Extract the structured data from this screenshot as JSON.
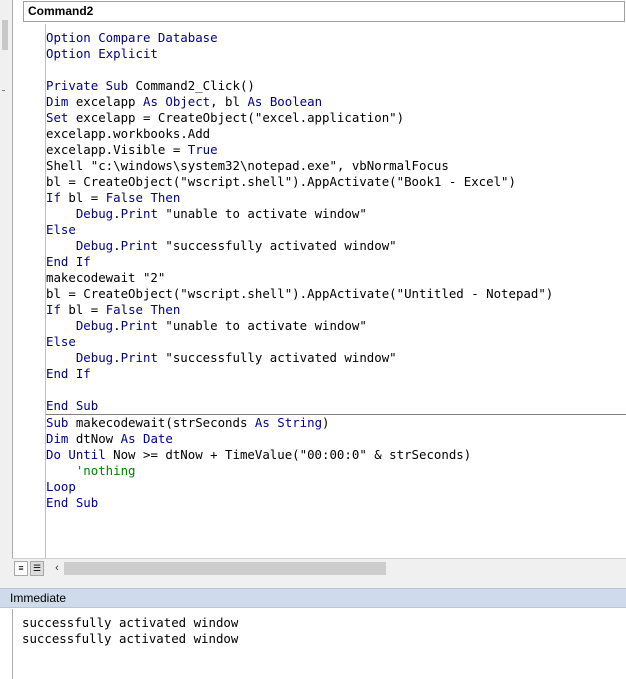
{
  "procedure_combo": {
    "value": "Command2"
  },
  "code_lines": [
    [
      {
        "t": "Option Compare Database",
        "c": "kw"
      }
    ],
    [
      {
        "t": "Option Explicit",
        "c": "kw"
      }
    ],
    [
      {
        "t": "",
        "c": "plain"
      }
    ],
    [
      {
        "t": "Private Sub ",
        "c": "kw"
      },
      {
        "t": "Command2_Click()",
        "c": "plain"
      }
    ],
    [
      {
        "t": "Dim ",
        "c": "kw"
      },
      {
        "t": "excelapp ",
        "c": "plain"
      },
      {
        "t": "As Object",
        "c": "kw"
      },
      {
        "t": ", bl ",
        "c": "plain"
      },
      {
        "t": "As Boolean",
        "c": "kw"
      }
    ],
    [
      {
        "t": "Set ",
        "c": "kw"
      },
      {
        "t": "excelapp = CreateObject(\"excel.application\")",
        "c": "plain"
      }
    ],
    [
      {
        "t": "excelapp.workbooks.Add",
        "c": "plain"
      }
    ],
    [
      {
        "t": "excelapp.Visible = ",
        "c": "plain"
      },
      {
        "t": "True",
        "c": "kw"
      }
    ],
    [
      {
        "t": "Shell \"c:\\windows\\system32\\notepad.exe\", vbNormalFocus",
        "c": "plain"
      }
    ],
    [
      {
        "t": "bl = CreateObject(\"wscript.shell\").AppActivate(\"Book1 - Excel\")",
        "c": "plain"
      }
    ],
    [
      {
        "t": "If ",
        "c": "kw"
      },
      {
        "t": "bl = ",
        "c": "plain"
      },
      {
        "t": "False Then",
        "c": "kw"
      }
    ],
    [
      {
        "t": "    Debug",
        "c": "kw"
      },
      {
        "t": ".",
        "c": "plain"
      },
      {
        "t": "Print ",
        "c": "kw"
      },
      {
        "t": "\"unable to activate window\"",
        "c": "plain"
      }
    ],
    [
      {
        "t": "Else",
        "c": "kw"
      }
    ],
    [
      {
        "t": "    Debug",
        "c": "kw"
      },
      {
        "t": ".",
        "c": "plain"
      },
      {
        "t": "Print ",
        "c": "kw"
      },
      {
        "t": "\"successfully activated window\"",
        "c": "plain"
      }
    ],
    [
      {
        "t": "End If",
        "c": "kw"
      }
    ],
    [
      {
        "t": "makecodewait \"2\"",
        "c": "plain"
      }
    ],
    [
      {
        "t": "bl = CreateObject(\"wscript.shell\").AppActivate(\"Untitled - Notepad\")",
        "c": "plain"
      }
    ],
    [
      {
        "t": "If ",
        "c": "kw"
      },
      {
        "t": "bl = ",
        "c": "plain"
      },
      {
        "t": "False Then",
        "c": "kw"
      }
    ],
    [
      {
        "t": "    Debug",
        "c": "kw"
      },
      {
        "t": ".",
        "c": "plain"
      },
      {
        "t": "Print ",
        "c": "kw"
      },
      {
        "t": "\"unable to activate window\"",
        "c": "plain"
      }
    ],
    [
      {
        "t": "Else",
        "c": "kw"
      }
    ],
    [
      {
        "t": "    Debug",
        "c": "kw"
      },
      {
        "t": ".",
        "c": "plain"
      },
      {
        "t": "Print ",
        "c": "kw"
      },
      {
        "t": "\"successfully activated window\"",
        "c": "plain"
      }
    ],
    [
      {
        "t": "End If",
        "c": "kw"
      }
    ],
    [
      {
        "t": "",
        "c": "plain"
      }
    ],
    [
      {
        "t": "End Sub",
        "c": "kw"
      }
    ],
    [
      {
        "t": "Sub ",
        "c": "kw"
      },
      {
        "t": "makecodewait(strSeconds ",
        "c": "plain"
      },
      {
        "t": "As String",
        "c": "kw"
      },
      {
        "t": ")",
        "c": "plain"
      }
    ],
    [
      {
        "t": "Dim ",
        "c": "kw"
      },
      {
        "t": "dtNow ",
        "c": "plain"
      },
      {
        "t": "As Date",
        "c": "kw"
      }
    ],
    [
      {
        "t": "Do Until ",
        "c": "kw"
      },
      {
        "t": "Now >= dtNow + TimeValue(\"00:00:0\" & strSeconds)",
        "c": "plain"
      }
    ],
    [
      {
        "t": "    'nothing",
        "c": "cmt"
      }
    ],
    [
      {
        "t": "Loop",
        "c": "kw"
      }
    ],
    [
      {
        "t": "End Sub",
        "c": "kw"
      }
    ]
  ],
  "immediate": {
    "title": "Immediate",
    "lines": [
      "successfully activated window",
      "successfully activated window"
    ]
  },
  "colors": {
    "keyword": "#00008b",
    "comment": "#008000",
    "text": "#000000",
    "pane_title_bg": "#cfdbea"
  },
  "icons": {
    "procedure_view": "procedure-view-icon",
    "full_module_view": "full-module-view-icon",
    "scroll_left": "scroll-left-arrow-icon"
  }
}
